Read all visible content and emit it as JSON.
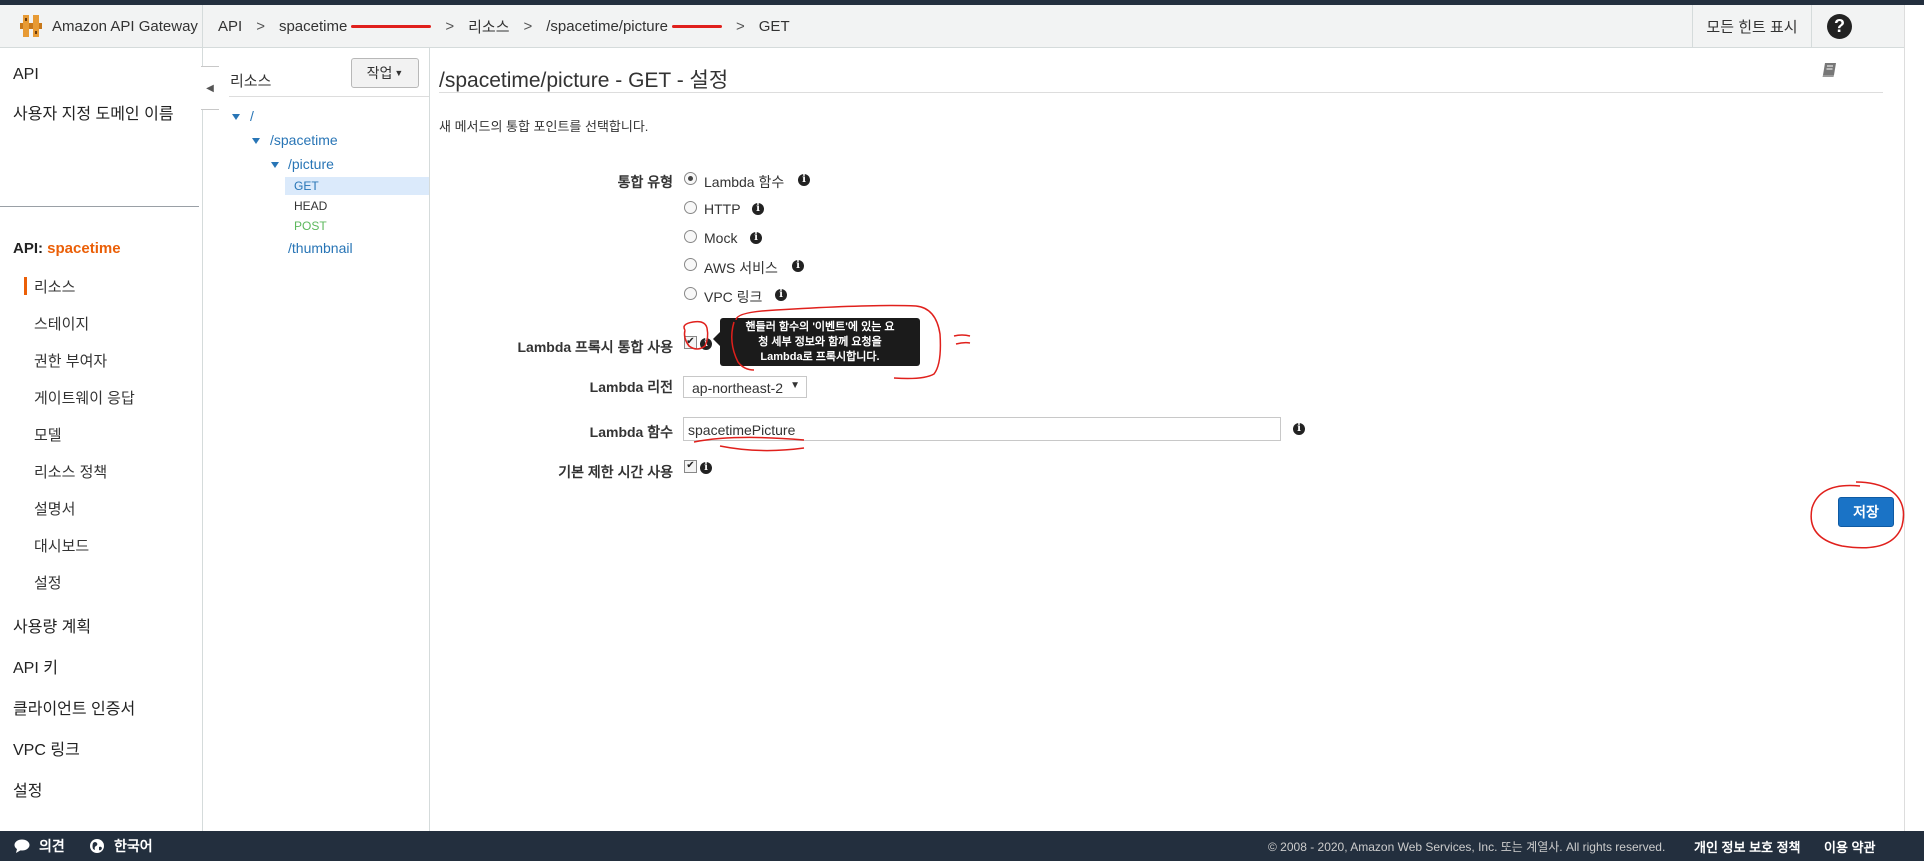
{
  "header": {
    "brand": "Amazon API Gateway",
    "crumbs": [
      "API",
      "spacetime",
      "리소스",
      "/spacetime/picture",
      "GET"
    ],
    "crumb_sep": ">",
    "hints": "모든 힌트 표시",
    "help": "?"
  },
  "leftnav": {
    "api": "API",
    "custom_domain": "사용자 지정 도메인 이름",
    "api_prefix": "API: ",
    "api_name": "spacetime",
    "sub": [
      "리소스",
      "스테이지",
      "권한 부여자",
      "게이트웨이 응답",
      "모델",
      "리소스 정책",
      "설명서",
      "대시보드",
      "설정"
    ],
    "bottom": [
      "사용량 계획",
      "API 키",
      "클라이언트 인증서",
      "VPC 링크",
      "설정"
    ]
  },
  "resources": {
    "title": "리소스",
    "action": "작업",
    "tree": {
      "root": "/",
      "spacetime": "/spacetime",
      "picture": "/picture",
      "get": "GET",
      "head": "HEAD",
      "post": "POST",
      "thumbnail": "/thumbnail"
    }
  },
  "main": {
    "title": "/spacetime/picture - GET - 설정",
    "subtitle": "새 메서드의 통합 포인트를 선택합니다.",
    "integration_label": "통합 유형",
    "integration_options": [
      "Lambda 함수",
      "HTTP",
      "Mock",
      "AWS 서비스",
      "VPC 링크"
    ],
    "selected_integration": "Lambda 함수",
    "proxy_label": "Lambda 프록시 통합 사용",
    "tooltip_lines": [
      "핸들러 함수의 '이벤트'에 있는 요",
      "청 세부 정보와 함께 요청을",
      "Lambda로 프록시합니다."
    ],
    "region_label": "Lambda 리전",
    "region_value": "ap-northeast-2",
    "function_label": "Lambda 함수",
    "function_value": "spacetimePicture",
    "timeout_label": "기본 제한 시간 사용",
    "save": "저장"
  },
  "footer": {
    "feedback": "의견",
    "language": "한국어",
    "copyright": "© 2008 - 2020, Amazon Web Services, Inc. 또는 계열사. All rights reserved.",
    "privacy": "개인 정보 보호 정책",
    "terms": "이용 약관"
  },
  "colors": {
    "accent": "#eb5f07",
    "link": "#2875b6",
    "save": "#1a73c6",
    "post": "#5cb85c",
    "annotation": "#e0201c"
  }
}
